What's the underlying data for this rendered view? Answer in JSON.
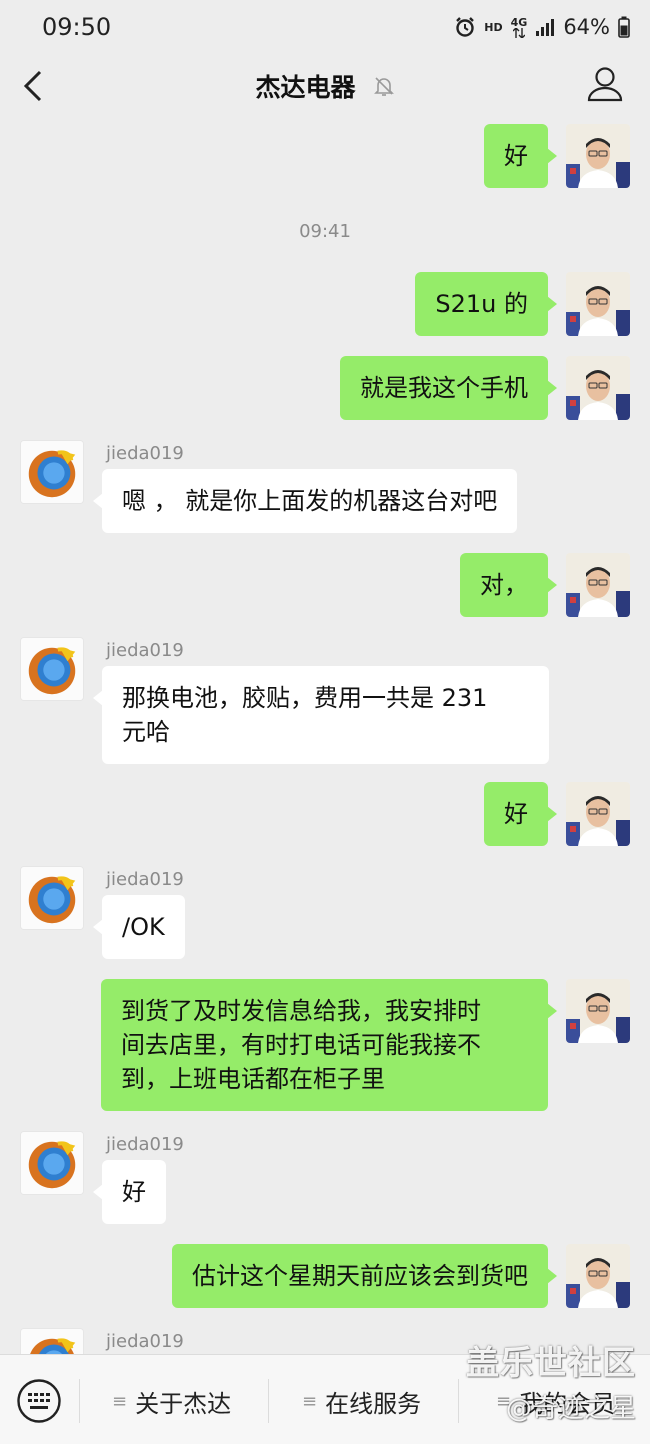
{
  "status_bar": {
    "time": "09:50",
    "hd": "HD",
    "network": "4G",
    "battery": "64%"
  },
  "header": {
    "title": "杰达电器"
  },
  "messages": {
    "m1": "好",
    "ts": "09:41",
    "m2": "S21u 的",
    "m3": "就是我这个手机",
    "s4": "jieda019",
    "m4": "嗯 ， 就是你上面发的机器这台对吧",
    "m5": "对，",
    "s6": "jieda019",
    "m6_l1": "那换电池，胶贴，费用一共是 231",
    "m6_l2": "元哈",
    "m7": "好",
    "s8": "jieda019",
    "m8": "/OK",
    "m9_l1": "到货了及时发信息给我，我安排时",
    "m9_l2": "间去店里，有时打电话可能我接不",
    "m9_l3": "到，上班电话都在柜子里",
    "s10": "jieda019",
    "m10": "好",
    "m11": "估计这个星期天前应该会到货吧",
    "s12": "jieda019"
  },
  "menu": {
    "item1": "关于杰达",
    "item2": "在线服务",
    "item3": "我的会员"
  },
  "watermark": {
    "line1": "盖乐世社区",
    "line2": "@奇迹之星"
  },
  "colors": {
    "outgoing_bubble": "#95ec69",
    "incoming_bubble": "#ffffff",
    "background": "#ededed"
  },
  "icons": [
    "back-arrow",
    "mute-bell",
    "person",
    "keyboard",
    "menu-lines"
  ]
}
